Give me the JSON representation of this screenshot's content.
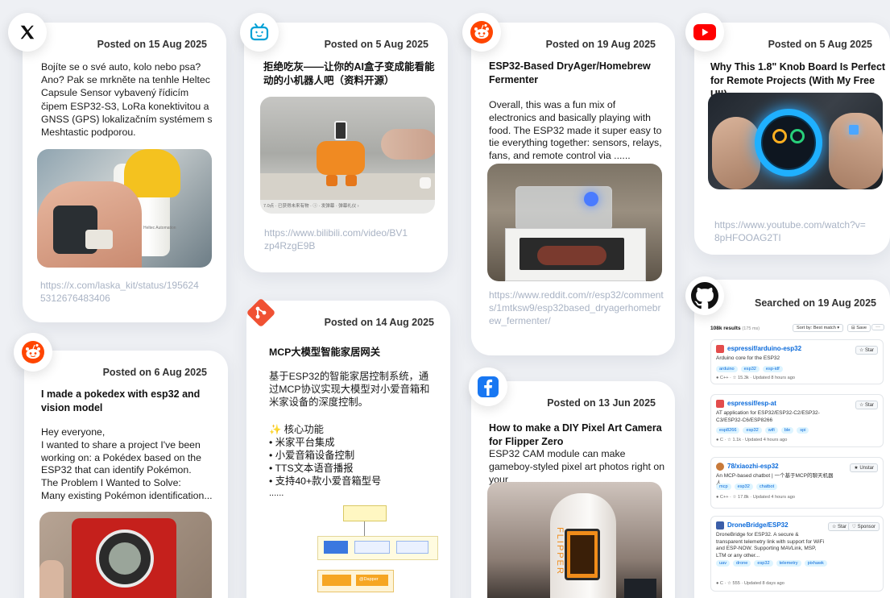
{
  "cards": {
    "x": {
      "date": "Posted on 15 Aug 2025",
      "body": "Bojíte se o své auto, kolo nebo psa? Ano? Pak se mrkněte na tenhle Heltec Capsule Sensor vybavený řídicím čipem ESP32-S3, LoRa konektivitou a GNSS (GPS) lokalizačním systémem s Meshtastic podporou.",
      "link": "https://x.com/laska_kit/status/1956245312676483406",
      "image_text": "Heltec Automation"
    },
    "bili": {
      "date": "Posted on 5 Aug 2025",
      "title": "拒绝吃灰——让你的AI盒子变成能看能动的小机器人吧（资料开源）",
      "link": "https://www.bilibili.com/video/BV1zp4RzgE9B",
      "image_caption": "7.0点 · 已获得未来有物 · ⓘ · 发弹幕 · 弹幕礼仪 ›"
    },
    "reddit1": {
      "date": "Posted on 19 Aug 2025",
      "title": "ESP32-Based DryAger/Homebrew Fermenter",
      "body": "Overall, this was a fun mix of electronics and basically playing with food. The ESP32 made it super easy to tie everything together: sensors, relays, fans, and remote control via ......",
      "link": "https://www.reddit.com/r/esp32/comments/1mtksw9/esp32based_dryagerhomebrew_fermenter/"
    },
    "youtube": {
      "date": "Posted on 5 Aug 2025",
      "title": "Why This 1.8\" Knob Board Is Perfect for Remote Projects (With My Free UI!)",
      "link": "https://www.youtube.com/watch?v=8pHFOOAG2TI"
    },
    "reddit2": {
      "date": "Posted on 6 Aug 2025",
      "title": "I made a pokedex with esp32 and vision model",
      "body": "Hey everyone,\nI wanted to share a project I've been working on: a Pokédex based on the ESP32 that can identify Pokémon.\nThe Problem I Wanted to Solve:\nMany existing Pokémon identification..."
    },
    "git": {
      "date": "Posted on 14 Aug 2025",
      "title": "MCP大模型智能家居网关",
      "body": "基于ESP32的智能家居控制系统，通过MCP协议实现大模型对小爱音箱和米家设备的深度控制。",
      "features_title": "✨ 核心功能",
      "features": [
        "米家平台集成",
        "小爱音箱设备控制",
        "TTS文本语音播报",
        "支持40+款小爱音箱型号"
      ],
      "more": "......",
      "diagram_label": "@Dapper"
    },
    "facebook": {
      "date": "Posted on 13 Jun 2025",
      "title": "How to make a DIY Pixel Art Camera for Flipper Zero",
      "body": "ESP32 CAM module can make gameboy-styled pixel art photos right on your",
      "image_text": "FLIPPER"
    },
    "github": {
      "date": "Searched on 19 Aug 2025",
      "results": "108k results",
      "results_time": "(175 ms)",
      "sort": "Sort by: Best match ▾",
      "save": "Save",
      "more": "···",
      "repos": [
        {
          "name": "espressif/arduino-esp32",
          "desc": "Arduino core for the ESP32",
          "tags": [
            "arduino",
            "esp32",
            "esp-idf"
          ],
          "meta": "● C++ · ☆ 15.3k · Updated 8 hours ago",
          "btn": "☆ Star",
          "color": "#e34c4c"
        },
        {
          "name": "espressif/esp-at",
          "desc": "AT application for ESP32/ESP32-C2/ESP32-C3/ESP32-C6/ESP8266",
          "tags": [
            "esp8266",
            "esp32",
            "wifi",
            "ble",
            "spi"
          ],
          "meta": "● C · ☆ 1.1k · Updated 4 hours ago",
          "btn": "☆ Star",
          "color": "#e34c4c"
        },
        {
          "name": "78/xiaozhi-esp32",
          "desc": "An MCP-based chatbot | 一个基于MCP的聊天机器人",
          "tags": [
            "mcp",
            "esp32",
            "chatbot"
          ],
          "meta": "● C++ · ☆ 17.8k · Updated 4 hours ago",
          "btn": "★ Unstar",
          "color": "#c87a3a"
        },
        {
          "name": "DroneBridge/ESP32",
          "desc": "DroneBridge for ESP32. A secure & transparent telemetry link with support for WiFi and ESP-NOW. Supporting MAVLink, MSP, LTM or any other...",
          "tags": [
            "uav",
            "drone",
            "esp32",
            "telemetry",
            "pixhawk"
          ],
          "meta": "● C · ☆ 555 · Updated 8 days ago",
          "btn": "☆ Star",
          "btn2": "♡ Sponsor",
          "color": "#3b5ea8"
        }
      ]
    }
  },
  "icons": {
    "x": "x-logo-icon",
    "bilibili": "bilibili-tv-icon",
    "reddit": "reddit-alien-icon",
    "youtube": "youtube-play-icon",
    "git": "git-diamond-icon",
    "facebook": "facebook-f-icon",
    "github": "github-octocat-icon"
  },
  "colors": {
    "reddit": "#ff4500",
    "youtube": "#ff0000",
    "git": "#f05133",
    "facebook": "#1877f2",
    "bilibili": "#00a1d6",
    "link": "#a9b3c4"
  }
}
